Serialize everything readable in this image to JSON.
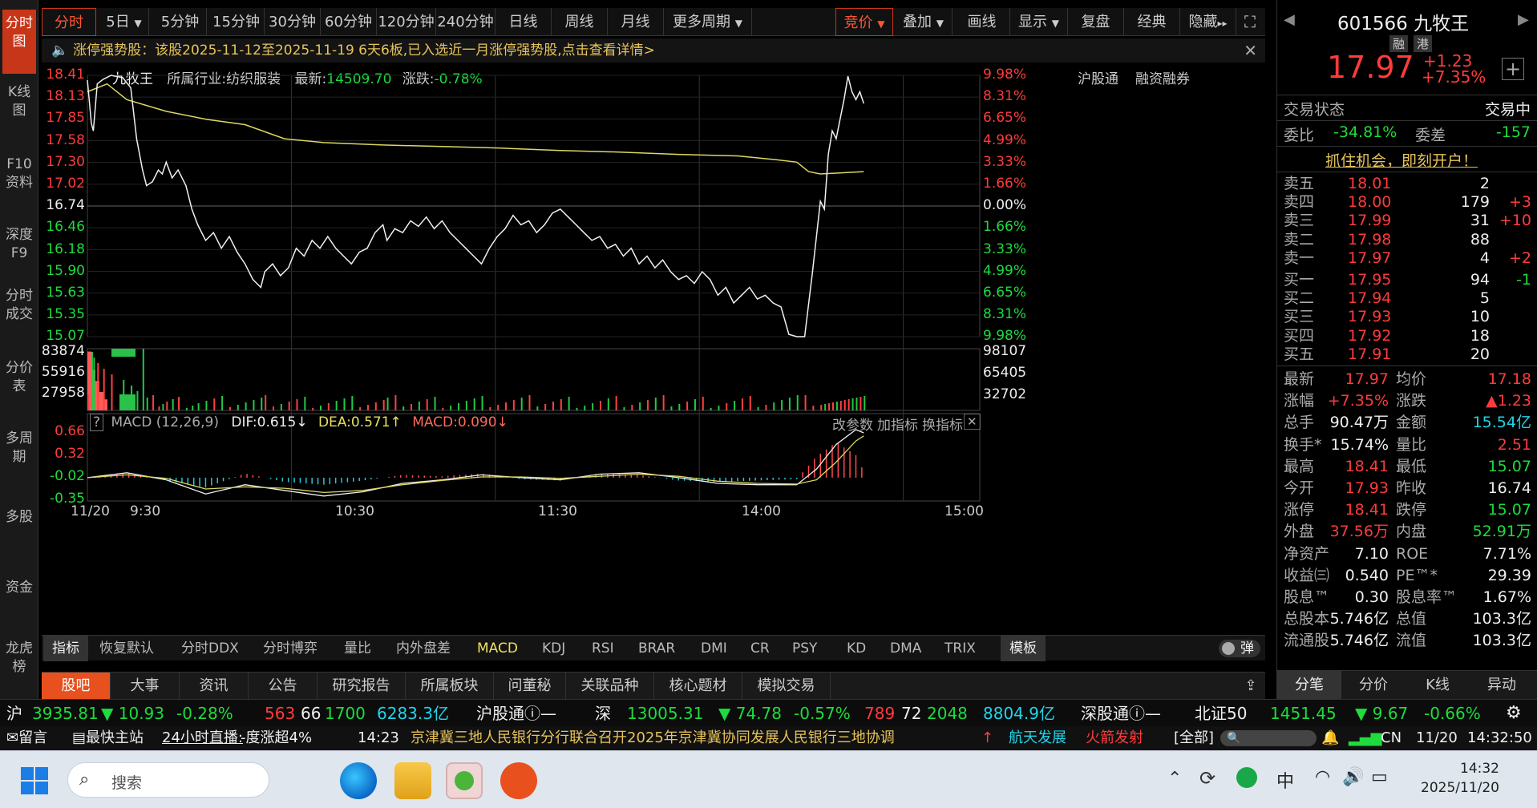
{
  "leftnav": {
    "items": [
      "分时图",
      "K线图",
      "F10资料",
      "深度F9",
      "分时成交",
      "分价表",
      "多周期",
      "多股",
      "资金",
      "龙虎榜"
    ]
  },
  "toolbar": {
    "periods": [
      "分时",
      "5日",
      "5分钟",
      "15分钟",
      "30分钟",
      "60分钟",
      "120分钟",
      "240分钟",
      "日线",
      "周线",
      "月线",
      "更多周期"
    ],
    "right": [
      "竞价",
      "叠加",
      "画线",
      "显示",
      "复盘",
      "经典",
      "隐藏"
    ]
  },
  "notice": {
    "text": "涨停强势股：该股2025-11-12至2025-11-19 6天6板,已入选近一月涨停强势股,点击查看详情>"
  },
  "chart_header": {
    "name": "九牧王",
    "industry_label": "所属行业:",
    "industry": "纺织服装",
    "latest_label": "最新:",
    "latest": "14509.70",
    "change_label": "涨跌:",
    "change": "-0.78%",
    "links": [
      "沪股通",
      "融资融券"
    ]
  },
  "price_axis": {
    "left": [
      "18.41",
      "18.13",
      "17.85",
      "17.58",
      "17.30",
      "17.02",
      "16.74",
      "16.46",
      "16.18",
      "15.90",
      "15.63",
      "15.35",
      "15.07"
    ],
    "right": [
      "9.98%",
      "8.31%",
      "6.65%",
      "4.99%",
      "3.33%",
      "1.66%",
      "0.00%",
      "1.66%",
      "3.33%",
      "4.99%",
      "6.65%",
      "8.31%",
      "9.98%"
    ]
  },
  "volume_axis": {
    "left": [
      "83874",
      "55916",
      "27958"
    ],
    "right": [
      "98107",
      "65405",
      "32702"
    ]
  },
  "macd": {
    "help": "?",
    "title": "MACD (12,26,9)",
    "dif": "DIF:0.615↓",
    "dea": "DEA:0.571↑",
    "macd": "MACD:0.090↓",
    "actions": [
      "改参数",
      "加指标",
      "换指标"
    ],
    "axis": [
      "0.66",
      "0.32",
      "-0.02",
      "-0.35"
    ]
  },
  "time_axis": [
    "11/20",
    "9:30",
    "10:30",
    "11:30",
    "14:00",
    "15:00"
  ],
  "indicator_tabs": [
    "指标",
    "恢复默认",
    "分时DDX",
    "分时博弈",
    "量比",
    "内外盘差",
    "MACD",
    "KDJ",
    "RSI",
    "BRAR",
    "DMI",
    "CR",
    "PSY",
    "KD",
    "DMA",
    "TRIX",
    "模板"
  ],
  "indicator_right": "弹",
  "bottom_tabs": [
    "股吧",
    "大事",
    "资讯",
    "公告",
    "研究报告",
    "所属板块",
    "问董秘",
    "关联品种",
    "核心题材",
    "模拟交易"
  ],
  "stock": {
    "code": "601566",
    "name": "九牧王",
    "tags": [
      "融",
      "港"
    ],
    "price": "17.97",
    "change": "+1.23",
    "change_pct": "+7.35%",
    "status_label": "交易状态",
    "status": "交易中",
    "weibi_label": "委比",
    "weibi": "-34.81%",
    "weicha_label": "委差",
    "weicha": "-157",
    "promo": "抓住机会，即刻开户！"
  },
  "orderbook": {
    "asks": [
      {
        "label": "卖五",
        "price": "18.01",
        "vol": "2",
        "delta": ""
      },
      {
        "label": "卖四",
        "price": "18.00",
        "vol": "179",
        "delta": "+3"
      },
      {
        "label": "卖三",
        "price": "17.99",
        "vol": "31",
        "delta": "+10"
      },
      {
        "label": "卖二",
        "price": "17.98",
        "vol": "88",
        "delta": ""
      },
      {
        "label": "卖一",
        "price": "17.97",
        "vol": "4",
        "delta": "+2"
      }
    ],
    "bids": [
      {
        "label": "买一",
        "price": "17.95",
        "vol": "94",
        "delta": "-1"
      },
      {
        "label": "买二",
        "price": "17.94",
        "vol": "5",
        "delta": ""
      },
      {
        "label": "买三",
        "price": "17.93",
        "vol": "10",
        "delta": ""
      },
      {
        "label": "买四",
        "price": "17.92",
        "vol": "18",
        "delta": ""
      },
      {
        "label": "买五",
        "price": "17.91",
        "vol": "20",
        "delta": ""
      }
    ]
  },
  "stats": [
    {
      "l1": "最新",
      "v1": "17.97",
      "c1": "red",
      "l2": "均价",
      "v2": "17.18",
      "c2": "red"
    },
    {
      "l1": "涨幅",
      "v1": "+7.35%",
      "c1": "red",
      "l2": "涨跌",
      "v2": "▲1.23",
      "c2": "red"
    },
    {
      "l1": "总手",
      "v1": "90.47万",
      "c1": "white",
      "l2": "金额",
      "v2": "15.54亿",
      "c2": "cyan"
    },
    {
      "l1": "换手*",
      "v1": "15.74%",
      "c1": "white",
      "l2": "量比",
      "v2": "2.51",
      "c2": "red"
    },
    {
      "l1": "最高",
      "v1": "18.41",
      "c1": "red",
      "l2": "最低",
      "v2": "15.07",
      "c2": "green"
    },
    {
      "l1": "今开",
      "v1": "17.93",
      "c1": "red",
      "l2": "昨收",
      "v2": "16.74",
      "c2": "white"
    },
    {
      "l1": "涨停",
      "v1": "18.41",
      "c1": "red",
      "l2": "跌停",
      "v2": "15.07",
      "c2": "green"
    },
    {
      "l1": "外盘",
      "v1": "37.56万",
      "c1": "red",
      "l2": "内盘",
      "v2": "52.91万",
      "c2": "green"
    },
    {
      "l1": "净资产",
      "v1": "7.10",
      "c1": "white",
      "l2": "ROE",
      "v2": "7.71%",
      "c2": "white"
    },
    {
      "l1": "收益㈢",
      "v1": "0.540",
      "c1": "white",
      "l2": "PE™*",
      "v2": "29.39",
      "c2": "white"
    },
    {
      "l1": "股息™",
      "v1": "0.30",
      "c1": "white",
      "l2": "股息率™",
      "v2": "1.67%",
      "c2": "white"
    },
    {
      "l1": "总股本",
      "v1": "5.746亿",
      "c1": "white",
      "l2": "总值",
      "v2": "103.3亿",
      "c2": "white"
    },
    {
      "l1": "流通股",
      "v1": "5.746亿",
      "c1": "white",
      "l2": "流值",
      "v2": "103.3亿",
      "c2": "white"
    }
  ],
  "right_tabs": [
    "分笔",
    "分价",
    "K线",
    "异动"
  ],
  "index_bar": {
    "sh_label": "沪",
    "sh_value": "3935.81",
    "sh_change": "▼ 10.93",
    "sh_pct": "-0.28%",
    "sh_up": "563",
    "sh_flat": "66",
    "sh_down": "1700",
    "sh_amount": "6283.3亿",
    "sh_connect": "沪股通",
    "sh_connect_val": "—",
    "sz_label": "深",
    "sz_value": "13005.31",
    "sz_change": "▼ 74.78",
    "sz_pct": "-0.57%",
    "sz_up": "789",
    "sz_flat": "72",
    "sz_down": "2048",
    "sz_amount": "8804.9亿",
    "sz_connect": "深股通",
    "sz_connect_val": "—",
    "bz_label": "北证50",
    "bz_value": "1451.45",
    "bz_change": "▼ 9.67",
    "bz_pct": "-0.66%"
  },
  "ticker": {
    "msg": "留言",
    "fast": "最快主站",
    "live": "24小时直播:",
    "live_text": "-度涨超4%",
    "time": "14:23",
    "news": "京津冀三地人民银行分行联合召开2025年京津冀协同发展人民银行三地协调",
    "hot1": "航天发展",
    "hot2": "火箭发射",
    "all": "[全部]",
    "region": "CN",
    "date": "11/20",
    "clock": "14:32:50"
  },
  "taskbar": {
    "search": "搜索",
    "lang": "中",
    "time": "14:32",
    "date": "2025/11/20"
  },
  "chart_data": {
    "type": "line",
    "title": "九牧王",
    "prev_close": 16.74,
    "ylim": [
      15.07,
      18.41
    ],
    "x_ticks": [
      "9:30",
      "10:30",
      "11:30",
      "14:00",
      "15:00"
    ],
    "price_points": [
      [
        0,
        18.35
      ],
      [
        2,
        17.8
      ],
      [
        3,
        17.7
      ],
      [
        5,
        18.3
      ],
      [
        8,
        18.36
      ],
      [
        12,
        18.41
      ],
      [
        18,
        18.38
      ],
      [
        22,
        18.25
      ],
      [
        25,
        17.6
      ],
      [
        28,
        17.2
      ],
      [
        30,
        17.0
      ],
      [
        33,
        17.05
      ],
      [
        36,
        17.2
      ],
      [
        38,
        17.15
      ],
      [
        40,
        17.3
      ],
      [
        43,
        17.1
      ],
      [
        46,
        17.2
      ],
      [
        50,
        17.0
      ],
      [
        53,
        16.7
      ],
      [
        56,
        16.5
      ],
      [
        60,
        16.3
      ],
      [
        64,
        16.4
      ],
      [
        68,
        16.2
      ],
      [
        72,
        16.35
      ],
      [
        76,
        16.15
      ],
      [
        80,
        16.0
      ],
      [
        84,
        15.8
      ],
      [
        88,
        15.7
      ],
      [
        90,
        15.9
      ],
      [
        94,
        16.0
      ],
      [
        98,
        15.85
      ],
      [
        102,
        15.95
      ],
      [
        106,
        16.2
      ],
      [
        110,
        16.1
      ],
      [
        114,
        16.3
      ],
      [
        118,
        16.2
      ],
      [
        122,
        16.35
      ],
      [
        126,
        16.2
      ],
      [
        130,
        16.1
      ],
      [
        134,
        16.0
      ],
      [
        138,
        16.15
      ],
      [
        142,
        16.2
      ],
      [
        146,
        16.4
      ],
      [
        150,
        16.5
      ],
      [
        152,
        16.3
      ],
      [
        156,
        16.45
      ],
      [
        160,
        16.4
      ],
      [
        164,
        16.55
      ],
      [
        168,
        16.48
      ],
      [
        172,
        16.6
      ],
      [
        176,
        16.45
      ],
      [
        180,
        16.55
      ],
      [
        184,
        16.4
      ],
      [
        188,
        16.3
      ],
      [
        192,
        16.2
      ],
      [
        196,
        16.1
      ],
      [
        200,
        16.0
      ],
      [
        204,
        16.2
      ],
      [
        208,
        16.35
      ],
      [
        212,
        16.45
      ],
      [
        216,
        16.62
      ],
      [
        220,
        16.5
      ],
      [
        224,
        16.55
      ],
      [
        228,
        16.4
      ],
      [
        232,
        16.5
      ],
      [
        236,
        16.65
      ],
      [
        240,
        16.7
      ],
      [
        244,
        16.6
      ],
      [
        248,
        16.5
      ],
      [
        252,
        16.4
      ],
      [
        256,
        16.3
      ],
      [
        260,
        16.35
      ],
      [
        264,
        16.2
      ],
      [
        268,
        16.25
      ],
      [
        272,
        16.1
      ],
      [
        276,
        16.2
      ],
      [
        280,
        16.0
      ],
      [
        284,
        16.1
      ],
      [
        288,
        15.95
      ],
      [
        292,
        16.05
      ],
      [
        296,
        15.9
      ],
      [
        300,
        15.8
      ],
      [
        304,
        15.85
      ],
      [
        308,
        15.75
      ],
      [
        312,
        15.9
      ],
      [
        316,
        15.8
      ],
      [
        320,
        15.6
      ],
      [
        324,
        15.7
      ],
      [
        328,
        15.5
      ],
      [
        332,
        15.6
      ],
      [
        336,
        15.7
      ],
      [
        340,
        15.55
      ],
      [
        344,
        15.6
      ],
      [
        348,
        15.5
      ],
      [
        352,
        15.45
      ],
      [
        356,
        15.1
      ],
      [
        360,
        15.07
      ],
      [
        364,
        15.07
      ],
      [
        368,
        15.9
      ],
      [
        372,
        16.8
      ],
      [
        374,
        16.7
      ],
      [
        376,
        17.4
      ],
      [
        378,
        17.7
      ],
      [
        380,
        17.6
      ],
      [
        382,
        17.85
      ],
      [
        384,
        18.1
      ],
      [
        386,
        18.4
      ],
      [
        388,
        18.2
      ],
      [
        390,
        18.1
      ],
      [
        392,
        18.2
      ],
      [
        394,
        18.05
      ]
    ],
    "avg_points": [
      [
        0,
        18.2
      ],
      [
        10,
        18.3
      ],
      [
        20,
        18.1
      ],
      [
        40,
        17.95
      ],
      [
        60,
        17.85
      ],
      [
        80,
        17.78
      ],
      [
        100,
        17.6
      ],
      [
        120,
        17.55
      ],
      [
        150,
        17.52
      ],
      [
        180,
        17.5
      ],
      [
        210,
        17.48
      ],
      [
        240,
        17.45
      ],
      [
        270,
        17.43
      ],
      [
        300,
        17.4
      ],
      [
        330,
        17.38
      ],
      [
        350,
        17.33
      ],
      [
        360,
        17.3
      ],
      [
        366,
        17.18
      ],
      [
        372,
        17.15
      ],
      [
        380,
        17.16
      ],
      [
        394,
        17.18
      ]
    ],
    "volume_ylim": [
      0,
      83874
    ],
    "volume_left_block_vol": [
      80000,
      55000,
      40000,
      25000,
      15000
    ],
    "macd_ylim": [
      -0.35,
      0.66
    ],
    "dif_points": [
      [
        0,
        -0.02
      ],
      [
        20,
        0.05
      ],
      [
        40,
        -0.05
      ],
      [
        60,
        -0.25
      ],
      [
        80,
        -0.12
      ],
      [
        100,
        -0.2
      ],
      [
        120,
        -0.28
      ],
      [
        140,
        -0.22
      ],
      [
        160,
        -0.1
      ],
      [
        180,
        -0.05
      ],
      [
        200,
        0.02
      ],
      [
        220,
        -0.02
      ],
      [
        240,
        -0.05
      ],
      [
        260,
        0.03
      ],
      [
        280,
        0.05
      ],
      [
        300,
        -0.02
      ],
      [
        320,
        -0.1
      ],
      [
        340,
        -0.12
      ],
      [
        360,
        -0.12
      ],
      [
        370,
        0.1
      ],
      [
        380,
        0.45
      ],
      [
        390,
        0.66
      ],
      [
        394,
        0.615
      ]
    ],
    "dea_points": [
      [
        0,
        -0.02
      ],
      [
        20,
        0.02
      ],
      [
        40,
        -0.03
      ],
      [
        60,
        -0.18
      ],
      [
        80,
        -0.15
      ],
      [
        100,
        -0.17
      ],
      [
        120,
        -0.23
      ],
      [
        140,
        -0.2
      ],
      [
        160,
        -0.12
      ],
      [
        180,
        -0.06
      ],
      [
        200,
        -0.01
      ],
      [
        220,
        -0.01
      ],
      [
        240,
        -0.03
      ],
      [
        260,
        0.0
      ],
      [
        280,
        0.03
      ],
      [
        300,
        0.0
      ],
      [
        320,
        -0.07
      ],
      [
        340,
        -0.1
      ],
      [
        360,
        -0.11
      ],
      [
        370,
        -0.05
      ],
      [
        380,
        0.2
      ],
      [
        390,
        0.5
      ],
      [
        394,
        0.571
      ]
    ],
    "total_minutes": 240
  }
}
